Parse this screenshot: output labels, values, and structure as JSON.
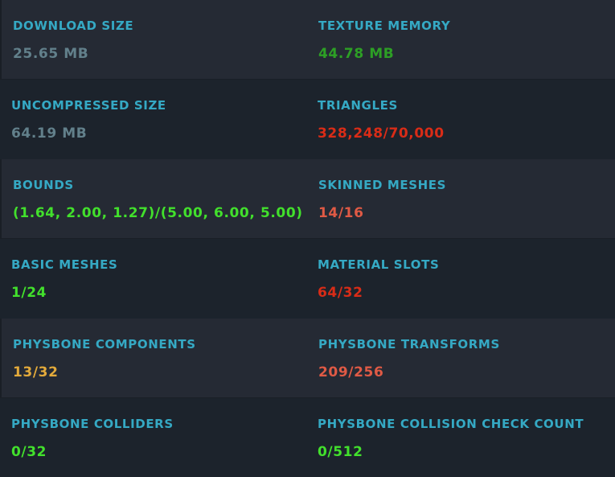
{
  "colors": {
    "label": "#35a9c4",
    "neutral": "#62808b",
    "good": "#42e02c",
    "good_dark": "#2d9f25",
    "warning": "#e3aa3b",
    "poor": "#e05a45",
    "very_poor": "#d92c17"
  },
  "rows": [
    {
      "left": {
        "label": "DOWNLOAD SIZE",
        "value": "25.65 MB",
        "rating": "neutral"
      },
      "right": {
        "label": "TEXTURE MEMORY",
        "value": "44.78 MB",
        "rating": "good_dark"
      }
    },
    {
      "left": {
        "label": "UNCOMPRESSED SIZE",
        "value": "64.19 MB",
        "rating": "neutral"
      },
      "right": {
        "label": "TRIANGLES",
        "value": "328,248/70,000",
        "rating": "very_poor"
      }
    },
    {
      "left": {
        "label": "BOUNDS",
        "value": "(1.64, 2.00, 1.27)/(5.00, 6.00, 5.00)",
        "rating": "good"
      },
      "right": {
        "label": "SKINNED MESHES",
        "value": "14/16",
        "rating": "poor"
      }
    },
    {
      "left": {
        "label": "BASIC MESHES",
        "value": "1/24",
        "rating": "good"
      },
      "right": {
        "label": "MATERIAL SLOTS",
        "value": "64/32",
        "rating": "very_poor"
      }
    },
    {
      "left": {
        "label": "PHYSBONE COMPONENTS",
        "value": "13/32",
        "rating": "warning"
      },
      "right": {
        "label": "PHYSBONE TRANSFORMS",
        "value": "209/256",
        "rating": "poor"
      }
    },
    {
      "left": {
        "label": "PHYSBONE COLLIDERS",
        "value": "0/32",
        "rating": "good"
      },
      "right": {
        "label": "PHYSBONE COLLISION CHECK COUNT",
        "value": "0/512",
        "rating": "good"
      }
    }
  ]
}
